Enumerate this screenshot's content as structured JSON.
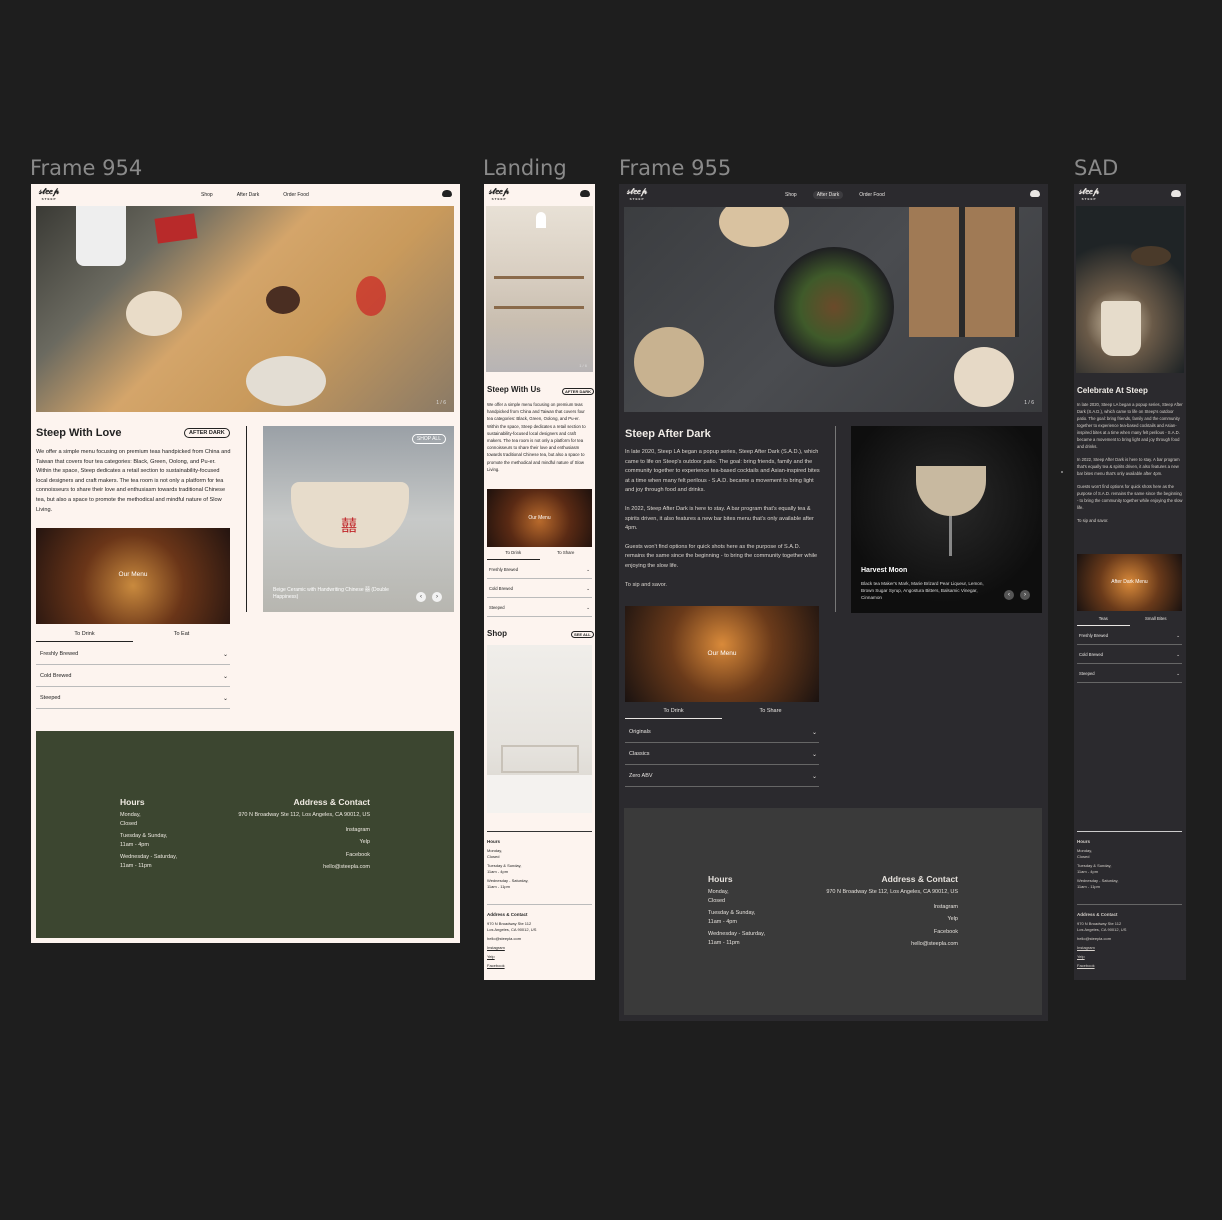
{
  "frames": {
    "f954": "Frame 954",
    "landing": "Landing",
    "f955": "Frame 955",
    "sad": "SAD"
  },
  "brand": {
    "logo": "𝓈𝓉𝑒𝑒𝓅",
    "word": "STEEP"
  },
  "nav": {
    "shop": "Shop",
    "after_dark": "After Dark",
    "order_food": "Order Food"
  },
  "f954": {
    "hero_counter": "1 / 6",
    "title": "Steep With Love",
    "pill": "AFTER DARK",
    "paragraph": "We offer a simple menu focusing on premium teas handpicked from China and Taiwan that covers four tea categories: Black, Green, Oolong, and Pu-er. Within the space, Steep dedicates a retail section to sustainability-focused local designers and craft makers. The tea room is not only a platform for tea connoisseurs to share their love and enthusiasm towards traditional Chinese tea, but also a space to promote the methodical and mindful nature of Slow Living.",
    "menu_label": "Our Menu",
    "tabs": [
      "To Drink",
      "To Eat"
    ],
    "accordion": [
      "Freshly Brewed",
      "Cold Brewed",
      "Steeped"
    ],
    "shop_all": "SHOP ALL",
    "product_caption": "Beige Ceramic with Handwriting Chinese 囍 (Double Happiness)",
    "product_glyph": "囍",
    "hours_title": "Hours",
    "hours": [
      "Monday,",
      "Closed",
      "Tuesday & Sunday,",
      "11am - 4pm",
      "Wednesday - Saturday,",
      "11am - 11pm"
    ],
    "address_title": "Address & Contact",
    "address": "970 N Broadway Ste 112, Los Angeles, CA 90012, US",
    "links": [
      "Instagram",
      "Yelp",
      "Facebook",
      "hello@steepla.com"
    ]
  },
  "landing": {
    "counter": "1 / 6",
    "title": "Steep With Us",
    "pill": "AFTER DARK",
    "paragraph": "We offer a simple menu focusing on premium teas handpicked from China and Taiwan that covers four tea categories: Black, Green, Oolong, and Pu-er. Within the space, Steep dedicates a retail section to sustainability-focused local designers and craft makers. The tea room is not only a platform for tea connoisseurs to share their love and enthusiasm towards traditional Chinese tea, but also a space to promote the methodical and mindful nature of Slow Living.",
    "menu_label": "Our Menu",
    "tabs": [
      "To Drink",
      "To Share"
    ],
    "accordion": [
      "Freshly Brewed",
      "Cold Brewed",
      "Steeped"
    ],
    "shop_title": "Shop",
    "see_all": "SEE ALL",
    "hours_title": "Hours",
    "hours": [
      "Monday,",
      "Closed",
      "Tuesday & Sunday,",
      "11am - 4pm",
      "Wednesday - Saturday,",
      "11am - 11pm"
    ],
    "address_title": "Address & Contact",
    "address": [
      "970 N Broadway Ste 112",
      "Los Angeles, CA 90012, US"
    ],
    "links": [
      "hello@steepla.com",
      "Instagram",
      "Yelp",
      "Facebook"
    ]
  },
  "f955": {
    "counter": "1 / 6",
    "title": "Steep After Dark",
    "paragraphs": [
      "In late 2020, Steep LA began a popup series, Steep After Dark (S.A.D.), which came to life on Steep's outdoor patio. The goal: bring friends, family and the community together to experience tea-based cocktails and Asian-inspired bites at a time when many felt perilous - S.A.D. became a movement to bring light and joy through food and drinks.",
      "In 2022, Steep After Dark is here to stay. A bar program that's equally tea & spirits driven, it also features a new bar bites menu that's only available after 4pm.",
      "Guests won't find options for quick shots here as the purpose of S.A.D. remains the same since the beginning - to bring the community together while enjoying the slow life.",
      "To sip and savor."
    ],
    "drink_name": "Harvest Moon",
    "drink_desc": "Black tea Maker's Mark, Marie Brizard Pear Liqueur, Lemon, Brown Sugar Syrup, Angostura Bitters, Balsamic Vinegar, Cinnamon",
    "menu_label": "Our Menu",
    "tabs": [
      "To Drink",
      "To Share"
    ],
    "accordion": [
      "Originals",
      "Classics",
      "Zero ABV"
    ],
    "hours_title": "Hours",
    "hours": [
      "Monday,",
      "Closed",
      "Tuesday & Sunday,",
      "11am - 4pm",
      "Wednesday - Saturday,",
      "11am - 11pm"
    ],
    "address_title": "Address & Contact",
    "address": "970 N Broadway Ste 112, Los Angeles, CA 90012, US",
    "links": [
      "Instagram",
      "Yelp",
      "Facebook",
      "hello@steepla.com"
    ]
  },
  "sad": {
    "title": "Celebrate At Steep",
    "paragraphs": [
      "In late 2020, Steep LA began a popup series, Steep After Dark (S.A.D.), which came to life on Steep's outdoor patio. The goal: bring friends, family and the community together to experience tea-based cocktails and Asian-inspired bites at a time when many felt perilous - S.A.D. became a movement to bring light and joy through food and drinks.",
      "In 2022, Steep After Dark is here to stay. A bar program that's equally tea & spirits driven, it also features a new bar bites menu that's only available after 4pm.",
      "Guests won't find options for quick shots here as the purpose of S.A.D. remains the same since the beginning - to bring the community together while enjoying the slow life.",
      "To sip and savor."
    ],
    "menu_label": "After Dark Menu",
    "tabs": [
      "Teas",
      "Small Bites"
    ],
    "accordion": [
      "Freshly Brewed",
      "Cold Brewed",
      "Steeped"
    ],
    "hours_title": "Hours",
    "hours": [
      "Monday,",
      "Closed",
      "Tuesday & Sunday,",
      "11am - 4pm",
      "Wednesday - Saturday,",
      "11am - 11pm"
    ],
    "address_title": "Address & Contact",
    "address": [
      "970 N Broadway Ste 112",
      "Los Angeles, CA 90012, US"
    ],
    "links": [
      "hello@steepla.com",
      "Instagram",
      "Yelp",
      "Facebook"
    ]
  },
  "colors": {
    "canvas": "#1e1e1e",
    "light_bg": "#fdf4ef",
    "dark_bg": "#2b2a2e",
    "footer_green": "#3c4630",
    "footer_gray": "#3a3a3a"
  }
}
